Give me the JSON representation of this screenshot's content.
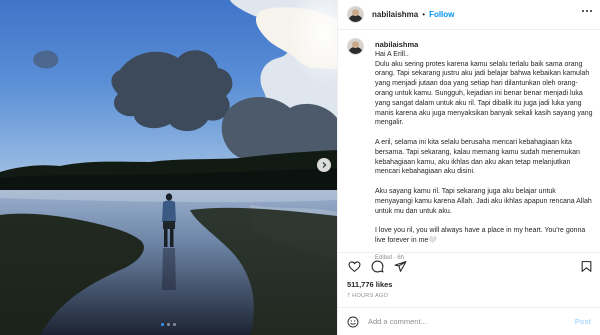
{
  "header": {
    "username": "nabilaishma",
    "separator": "•",
    "follow_label": "Follow",
    "more_icon": "more-horizontal-icon"
  },
  "caption": {
    "username": "nabilaishma",
    "paragraphs": [
      "Hai A Erill..",
      "Dulu aku sering protes karena kamu selalu terlalu baik sama orang orang. Tapi sekarang justru aku jadi belajar bahwa kebaikan kamulah yang menjadi jutaan doa yang setiap hari dilantunkan oleh orang-orang untuk kamu. Sungguh, kejadian ini benar benar menjadi luka yang sangat dalam untuk aku ril. Tapi dibalik itu juga jadi luka yang manis karena aku juga menyaksikan banyak sekali kasih sayang yang mengalir.",
      "A eril, selama ini kita selalu berusaha mencari kebahagiaan kita bersama. Tapi sekarang, kalau memang kamu sudah menemukan kebahagiaan kamu, aku ikhlas dan aku akan tetap melanjutkan mencari kebahagiaan aku disini.",
      "Aku sayang kamu ril. Tapi sekarang juga aku belajar untuk menyayangi kamu karena Allah. Jadi aku ikhlas apapun rencana Allah untuk mu dan untuk aku.",
      "I love you ril, you will always have a place in my heart. You're gonna live forever in me🤍"
    ],
    "edited": "Edited · 6h"
  },
  "actions": {
    "like_icon": "heart-icon",
    "comment_icon": "comment-icon",
    "share_icon": "share-icon",
    "save_icon": "bookmark-icon",
    "likes": "511,776 likes",
    "time_ago": "7 HOURS AGO"
  },
  "comment": {
    "emoji_icon": "emoji-icon",
    "placeholder": "Add a comment...",
    "post_label": "Post"
  },
  "media": {
    "next_icon": "chevron-right-icon",
    "carousel_count": 3,
    "carousel_active": 1
  },
  "colors": {
    "link_blue": "#0095f6",
    "post_disabled": "#b3dbff",
    "active_dot": "#3797f0",
    "muted_text": "#8e8e8e"
  }
}
